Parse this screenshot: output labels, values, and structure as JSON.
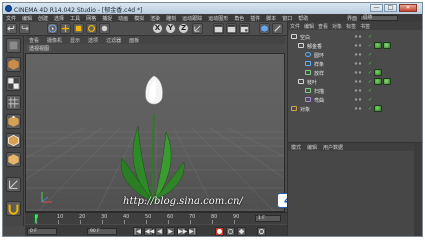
{
  "window": {
    "title": "CINEMA 4D R14.042 Studio - [郁金香.c4d *]",
    "minimize": "—",
    "maximize": "□",
    "close": "✕"
  },
  "menubar": {
    "items": [
      "文件",
      "编辑",
      "创建",
      "选择",
      "工具",
      "网格",
      "捕捉",
      "动画",
      "模拟",
      "渲染",
      "雕刻",
      "运动跟踪",
      "运动图形",
      "角色",
      "插件",
      "脚本",
      "窗口",
      "帮助"
    ],
    "layout_label": "界面",
    "layout_value": "启动"
  },
  "toolbar": {
    "axis_buttons": [
      "X",
      "Y",
      "Z"
    ]
  },
  "viewport": {
    "menu": [
      "查看",
      "摄像机",
      "显示",
      "选项",
      "过滤器",
      "面板"
    ],
    "label": "透视视图"
  },
  "object_manager": {
    "menu": [
      "文件",
      "编辑",
      "查看",
      "对象",
      "标签",
      "书签"
    ],
    "rows": [
      {
        "name": "空白",
        "indent": 0,
        "icon": "null-icon",
        "tags": 0
      },
      {
        "name": "郁金香",
        "indent": 1,
        "icon": "null-icon",
        "tags": 2
      },
      {
        "name": "圆环",
        "indent": 2,
        "icon": "circle-icon",
        "tags": 0
      },
      {
        "name": "样条",
        "indent": 2,
        "icon": "spline-icon",
        "tags": 0
      },
      {
        "name": "放样",
        "indent": 2,
        "icon": "loft-icon",
        "tags": 1
      },
      {
        "name": "枝叶",
        "indent": 1,
        "icon": "null-icon",
        "tags": 2
      },
      {
        "name": "扫描",
        "indent": 2,
        "icon": "sweep-icon",
        "tags": 0
      },
      {
        "name": "弯曲",
        "indent": 2,
        "icon": "bend-icon",
        "tags": 0
      },
      {
        "name": "对象",
        "indent": 0,
        "icon": "object-icon",
        "tags": 1
      }
    ]
  },
  "attribute_manager": {
    "menu": [
      "模式",
      "编辑",
      "用户数据"
    ]
  },
  "timeline": {
    "ticks": [
      "0",
      "10",
      "20",
      "30",
      "40",
      "50",
      "60",
      "70",
      "80",
      "90"
    ],
    "current_frame": "1 F"
  },
  "transport": {
    "start_field": "0 F",
    "end_field": "90 F",
    "buttons": [
      "|◀",
      "◀◀",
      "◀",
      "▶",
      "▶▶",
      "▶|"
    ]
  },
  "watermark": {
    "text": "http://blog.sina.com.cn/",
    "badge": "4DKJ"
  },
  "colors": {
    "accent_green": "#2fd35b",
    "title_bar": "#b9ccdd",
    "panel_bg": "#4a4a4a"
  }
}
